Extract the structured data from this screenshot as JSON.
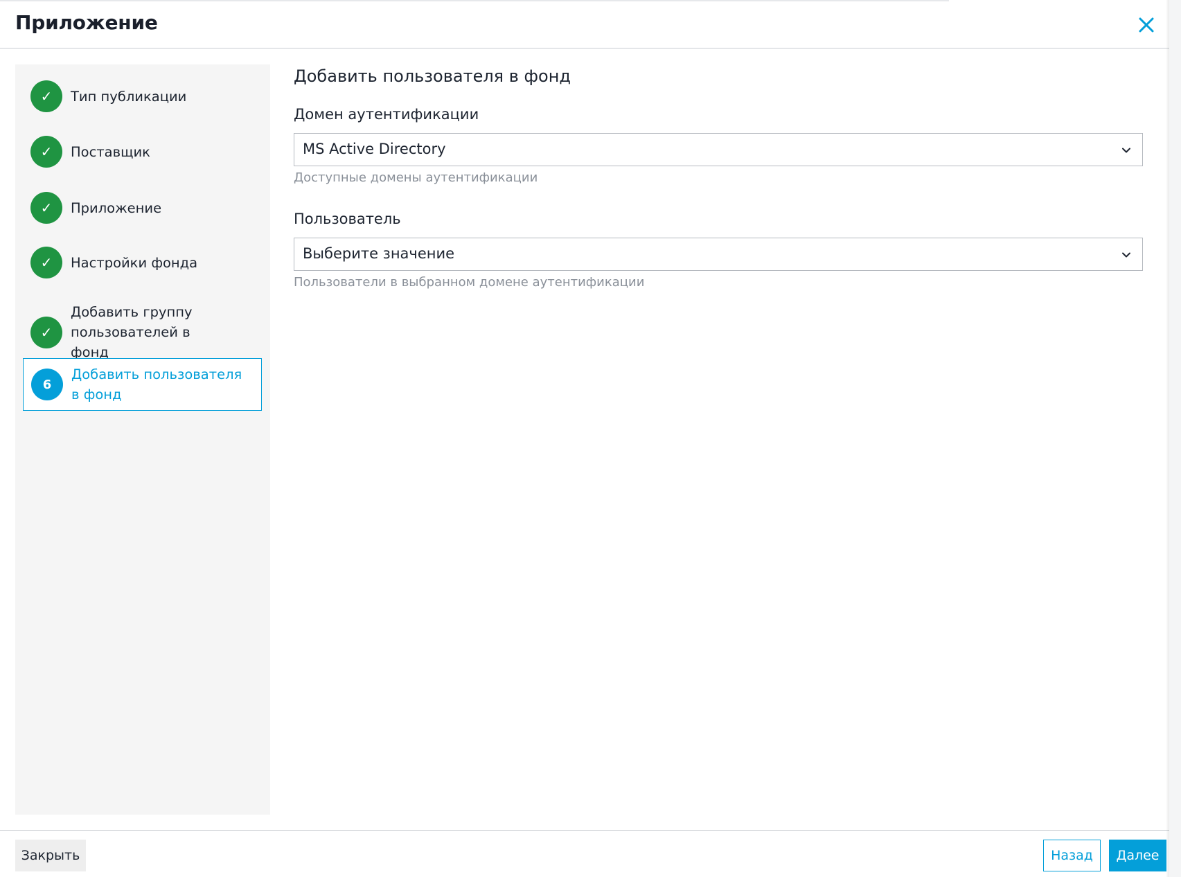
{
  "window": {
    "title": "Приложение",
    "close_icon": "close-icon"
  },
  "wizard": {
    "steps": [
      {
        "label": "Тип публикации",
        "status": "completed",
        "icon": "check-icon"
      },
      {
        "label": "Поставщик",
        "status": "completed",
        "icon": "check-icon"
      },
      {
        "label": "Приложение",
        "status": "completed",
        "icon": "check-icon"
      },
      {
        "label": "Настройки фонда",
        "status": "completed",
        "icon": "check-icon"
      },
      {
        "label": "Добавить группу пользователей в фонд",
        "status": "completed",
        "icon": "check-icon"
      },
      {
        "label": "Добавить пользователя в фонд",
        "status": "active",
        "number": "6"
      }
    ],
    "check_glyph": "✓"
  },
  "form": {
    "title": "Добавить пользователя в фонд",
    "auth_domain": {
      "label": "Домен аутентификации",
      "value": "MS Active Directory",
      "help": "Доступные домены аутентификации"
    },
    "user": {
      "label": "Пользователь",
      "value": "Выберите значение",
      "help": "Пользователи в выбранном домене аутентификации"
    }
  },
  "footer": {
    "close_label": "Закрыть",
    "back_label": "Назад",
    "next_label": "Далее"
  },
  "colors": {
    "accent": "#049fd9",
    "completed": "#1f9442",
    "sidebar_bg": "#f5f5f5",
    "help_text": "#8a9099"
  }
}
